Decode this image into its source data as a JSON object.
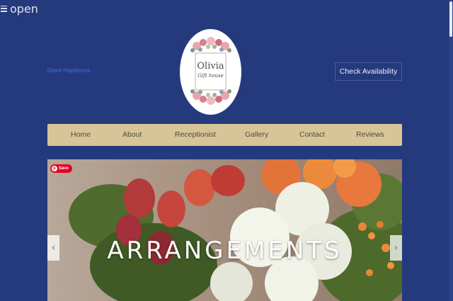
{
  "menu": {
    "open_label": "open",
    "icon": "hamburger-icon"
  },
  "header": {
    "tagline": "Share Happiness",
    "logo": {
      "line1": "Olivia",
      "line2": "Gift house"
    },
    "check_availability_label": "Check Availability"
  },
  "nav": {
    "items": [
      {
        "label": "Home"
      },
      {
        "label": "About"
      },
      {
        "label": "Receptionist"
      },
      {
        "label": "Gallery"
      },
      {
        "label": "Contact"
      },
      {
        "label": "Reviews"
      }
    ]
  },
  "hero": {
    "title": "ARRANGEMENTS",
    "save_label": "Save",
    "prev_icon": "chevron-left-icon",
    "next_icon": "chevron-right-icon"
  },
  "colors": {
    "page_bg": "#253a7d",
    "nav_bg": "#d8c597",
    "tagline": "#3a6df0",
    "save_badge": "#e60023"
  }
}
